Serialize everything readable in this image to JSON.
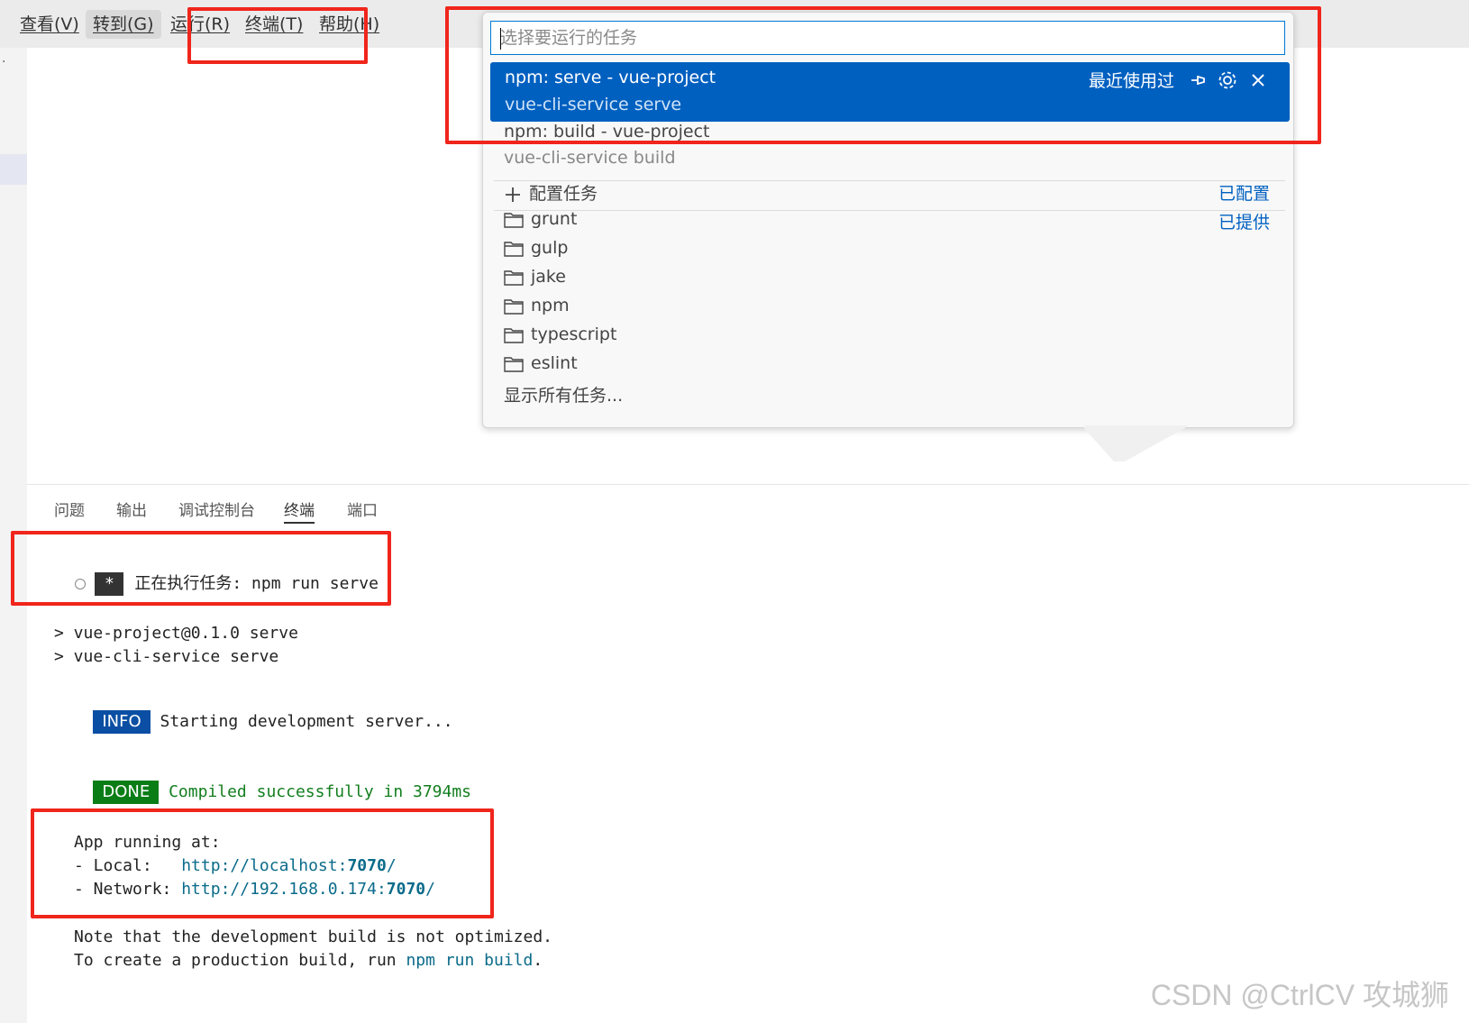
{
  "menu": {
    "items": [
      "查看(V)",
      "转到(G)",
      "运行(R)",
      "终端(T)",
      "帮助(H)"
    ]
  },
  "quick_pick": {
    "placeholder": "选择要运行的任务",
    "selected": {
      "label": "npm: serve - vue-project",
      "detail": "vue-cli-service serve",
      "recent": "最近使用过"
    },
    "second": {
      "label": "npm: build - vue-project",
      "detail": "vue-cli-service build"
    },
    "configure": {
      "label": "配置任务",
      "tag": "已配置"
    },
    "provided_tag": "已提供",
    "folders": [
      "grunt",
      "gulp",
      "jake",
      "npm",
      "typescript",
      "eslint"
    ],
    "show_all": "显示所有任务..."
  },
  "panel": {
    "tabs": [
      "问题",
      "输出",
      "调试控制台",
      "终端",
      "端口"
    ],
    "active_tab": "终端"
  },
  "terminal": {
    "task_line": "正在执行任务: npm run serve",
    "task_badge": "*",
    "cmd1": "> vue-project@0.1.0 serve",
    "cmd2": "> vue-cli-service serve",
    "info_badge": "INFO",
    "info_text": "Starting development server...",
    "done_badge": "DONE",
    "done_text": "Compiled successfully in 3794ms",
    "app_running": "App running at:",
    "local_label": "- Local:   ",
    "local_url_prefix": "http://localhost:",
    "local_port": "7070",
    "network_label": "- Network: ",
    "network_url_prefix": "http://192.168.0.174:",
    "network_port": "7070",
    "note1": "Note that the development build is not optimized.",
    "note2_prefix": "To create a production build, run ",
    "note2_cmd": "npm run build",
    "note2_suffix": "."
  },
  "watermark": "CSDN @CtrlCV 攻城狮",
  "colors": {
    "accent": "#0060c0",
    "annotation_red": "#f0251b",
    "info": "#0a4fa3",
    "done": "#0b7d17"
  }
}
